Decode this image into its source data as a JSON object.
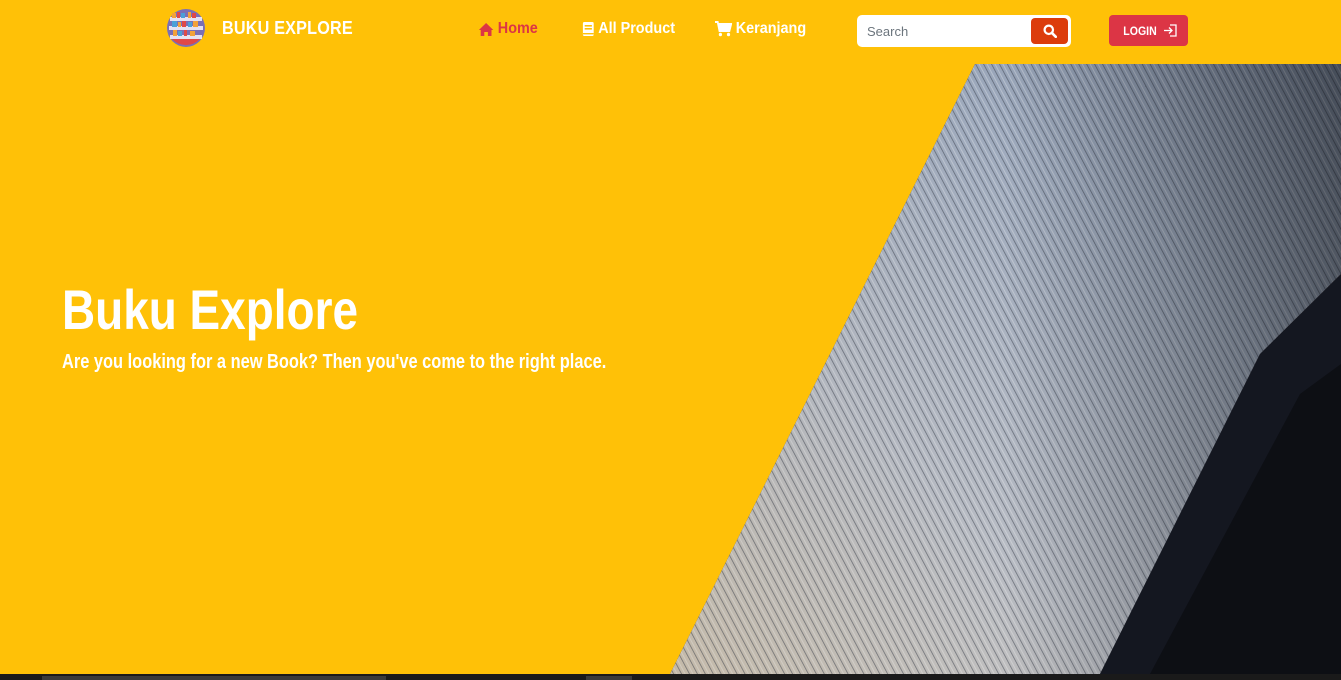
{
  "brand": {
    "name": "BUKU EXPLORE",
    "logo_icon": "bookshelf-logo-icon"
  },
  "nav": {
    "items": [
      {
        "label": "Home",
        "icon": "home-icon",
        "active": true
      },
      {
        "label": "All Product",
        "icon": "book-icon",
        "active": false
      },
      {
        "label": "Keranjang",
        "icon": "cart-icon",
        "active": false
      }
    ]
  },
  "search": {
    "placeholder": "Search",
    "value": "",
    "button_icon": "search-icon"
  },
  "login": {
    "label": "LOGIN",
    "icon": "login-arrow-icon"
  },
  "hero": {
    "title": "Buku Explore",
    "subtitle": "Are you looking for a new Book? Then you've come to the right place.",
    "image": "open-book-pages-photo"
  },
  "colors": {
    "background": "#ffc107",
    "accent": "#dc3545",
    "search_button": "#dc3c0c",
    "text": "#ffffff"
  }
}
